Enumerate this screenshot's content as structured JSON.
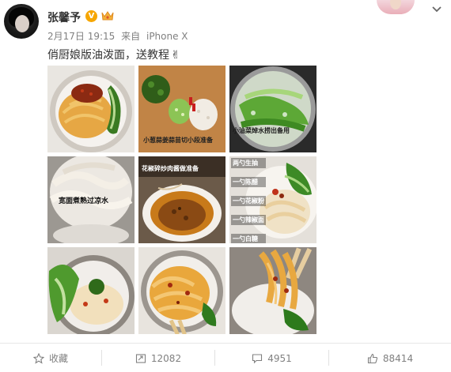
{
  "author": {
    "name": "张馨予",
    "verified_badge": "V"
  },
  "meta": {
    "date": "2月17日 19:15",
    "from_label": "来自",
    "device": "iPhone X"
  },
  "post": {
    "text": "俏厨娘版油泼面，送教程",
    "emoji": "✌"
  },
  "images": [
    {
      "caption": ""
    },
    {
      "caption": "小葱蒜姜蒜苗切小段准备"
    },
    {
      "caption": "小油菜焯水捞出备用"
    },
    {
      "caption": "宽面煮熟过凉水"
    },
    {
      "caption": "花椒碎炒肉酱做准备"
    },
    {
      "caption": ""
    },
    {
      "caption": ""
    },
    {
      "caption": ""
    },
    {
      "caption": ""
    }
  ],
  "sauce_steps": [
    "两勺生抽",
    "一勺陈醋",
    "一勺花椒粉",
    "一勺辣椒面",
    "一勺白糖"
  ],
  "actions": {
    "favorite": "收藏",
    "repost": "12082",
    "comment": "4951",
    "like": "88414"
  },
  "colors": {
    "badge": "#f6a600",
    "meta_text": "#808080",
    "divider": "#e6e6e6"
  }
}
